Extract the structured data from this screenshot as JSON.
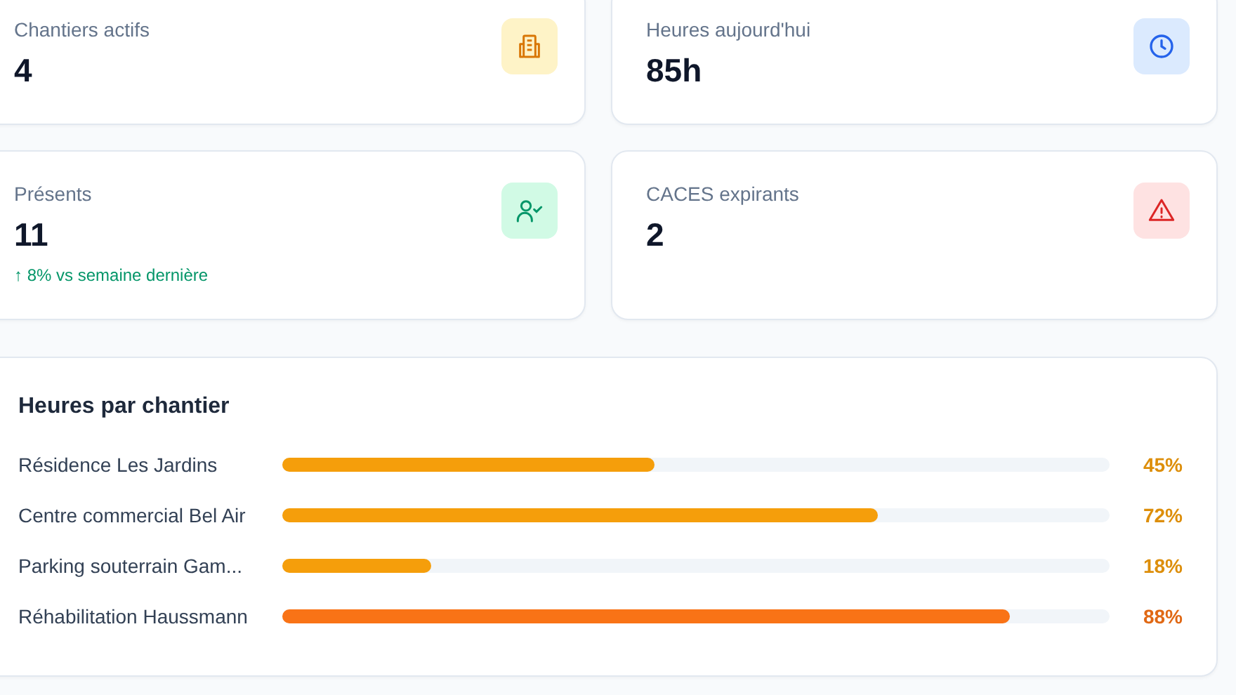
{
  "stats": [
    {
      "label": "Chantiers actifs",
      "value": "4",
      "kind": "building"
    },
    {
      "label": "Heures aujourd'hui",
      "value": "85h",
      "kind": "clock"
    },
    {
      "label": "Présents",
      "value": "11",
      "kind": "people",
      "trend": "↑ 8% vs semaine dernière"
    },
    {
      "label": "CACES expirants",
      "value": "2",
      "kind": "alert"
    }
  ],
  "hours_by_site": {
    "title": "Heures par chantier",
    "rows": [
      {
        "name": "Résidence Les Jardins",
        "level": 0.45,
        "reading": "45%",
        "color": "#f59e0b"
      },
      {
        "name": "Centre commercial Bel Air",
        "level": 0.72,
        "reading": "72%",
        "color": "#f59e0b"
      },
      {
        "name": "Parking souterrain Gam...",
        "level": 0.18,
        "reading": "18%",
        "color": "#f59e0b"
      },
      {
        "name": "Réhabilitation Haussmann",
        "level": 0.88,
        "reading": "88%",
        "color": "#f97316"
      }
    ]
  }
}
